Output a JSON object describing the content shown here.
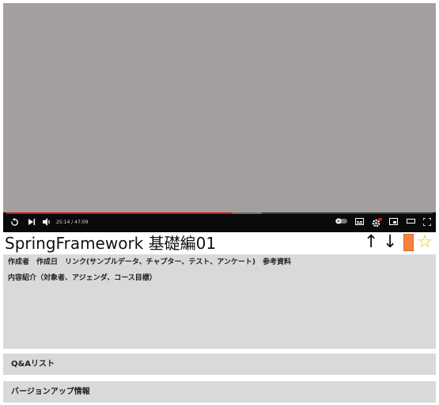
{
  "player": {
    "time_current": "25:14",
    "time_total": "47:09",
    "timecode": "25:14 / 47:09",
    "played_fraction": 0.53,
    "buffered_fraction": 0.6,
    "progress_color": "#c81c1c",
    "controls": {
      "replay": "replay-icon",
      "next": "skip-next-icon",
      "volume": "volume-icon",
      "autoplay": "autoplay-toggle-icon",
      "subtitles": "subtitles-icon",
      "settings": "settings-gear-icon",
      "miniplayer": "miniplayer-icon",
      "theater": "theater-mode-icon",
      "fullscreen": "fullscreen-icon"
    }
  },
  "video": {
    "title": "SpringFramework 基礎編01"
  },
  "title_actions": {
    "up": "↑",
    "down": "↓",
    "star": "☆",
    "accent_color": "#f4823c",
    "star_color": "#f2c200"
  },
  "info": {
    "links": [
      "作成者",
      "作成日",
      "リンク(サンプルデータ、チャプター、テスト、アンケート)",
      "参考資料"
    ],
    "description": "内容紹介（対象者、アジェンダ、コース目標）"
  },
  "sections": {
    "qa_list": "Q&Aリスト",
    "version_up": "バージョンアップ情報"
  }
}
